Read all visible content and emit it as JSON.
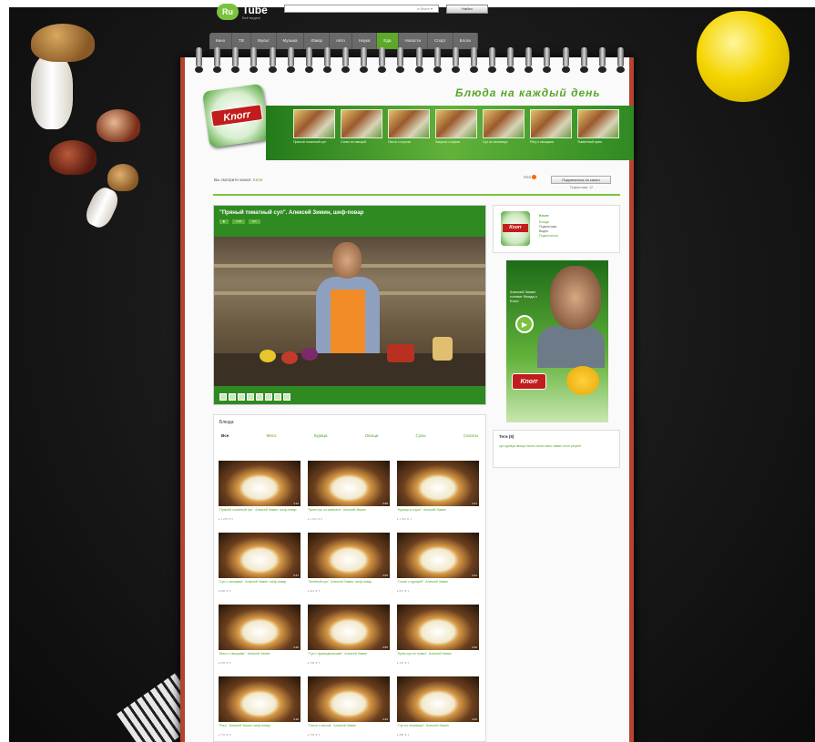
{
  "rutube": {
    "logo": "Ru",
    "name": "Tube",
    "tagline": "Всё видео!",
    "search_scope": "в блоге",
    "search_button": "Найти"
  },
  "topnav": [
    "Кино",
    "ТВ",
    "Мульт",
    "Музыка",
    "Юмор",
    "Авто",
    "Наука",
    "Еда",
    "Новости",
    "Спорт",
    "Блоги"
  ],
  "topnav_active": 7,
  "brand": {
    "logo": "Knorr",
    "slogan": "Блюда на каждый день"
  },
  "strip": [
    "Пряный томатный суп",
    "Салат из овощей",
    "Паста с соусом",
    "Закуска с сыром",
    "Суп из чечевицы",
    "Рагу с овощами",
    "Тыквенный крем"
  ],
  "chosen": {
    "label": "Вы смотрите канал:",
    "value": "Knorr"
  },
  "rss": "RSS",
  "subscribe": {
    "button": "Подписаться на канал",
    "sub": "Подписчики: 12"
  },
  "player": {
    "title": "\"Пряный томатный суп\". Алексей Зимин, шеф-повар",
    "controls": [
      "▶",
      "0:00",
      "HD"
    ]
  },
  "dishes": {
    "title": "Блюда",
    "filters": [
      "Все",
      "Мясо",
      "Курица",
      "Овощи",
      "Супы",
      "Салаты"
    ],
    "active_filter": 0,
    "items": [
      {
        "caption": "\"Пряный томатный суп\". Алексей Зимин, шеф-повар",
        "meta": "▸ 1 245  ★ 5",
        "dur": "4:12"
      },
      {
        "caption": "\"Крем-суп из шпината\". Алексей Зимин",
        "meta": "▸ 1 102  ★ 5",
        "dur": "3:58"
      },
      {
        "caption": "\"Курица в соусе\". Алексей Зимин",
        "meta": "▸ 1 034  ★ 4",
        "dur": "4:31"
      },
      {
        "caption": "\"Суп с овощами\". Алексей Зимин, шеф-повар",
        "meta": "▸ 986  ★ 5",
        "dur": "3:47"
      },
      {
        "caption": "\"Зелёный суп\". Алексей Зимин, шеф-повар",
        "meta": "▸ 912  ★ 5",
        "dur": "4:05"
      },
      {
        "caption": "\"Салат с курицей\". Алексей Зимин",
        "meta": "▸ 870  ★ 4",
        "dur": "3:22"
      },
      {
        "caption": "\"Мясо с овощами\". Алексей Зимин",
        "meta": "▸ 845  ★ 5",
        "dur": "4:40"
      },
      {
        "caption": "\"Суп с фрикадельками\". Алексей Зимин",
        "meta": "▸ 798  ★ 5",
        "dur": "3:55"
      },
      {
        "caption": "\"Крем-суп из тыквы\". Алексей Зимин",
        "meta": "▸ 764  ★ 4",
        "dur": "3:30"
      },
      {
        "caption": "\"Рагу\". Алексей Зимин, шеф-повар",
        "meta": "▸ 731  ★ 5",
        "dur": "4:18"
      },
      {
        "caption": "\"Паста с мясом\". Алексей Зимин",
        "meta": "▸ 702  ★ 5",
        "dur": "3:49"
      },
      {
        "caption": "\"Суп из чечевицы\". Алексей Зимин",
        "meta": "▸ 688  ★ 4",
        "dur": "4:02"
      }
    ]
  },
  "brand_card": {
    "logo": "Knorr",
    "name": "Knorr",
    "lines": [
      "Блюда",
      "Подписчики",
      "Видео",
      "Подписаться"
    ]
  },
  "ad": {
    "text": "Алексей Зимин готовит блюда с Knorr",
    "play": "▶",
    "logo": "Knorr"
  },
  "tags": {
    "title": "Теги (9)",
    "list": "суп  курица  овощи  паста  салат  мясо  зимин  knorr  рецепт"
  },
  "colors": {
    "accent": "#5daa2b",
    "notebook_border": "#b5432f",
    "knorr_red": "#c21d1d"
  }
}
